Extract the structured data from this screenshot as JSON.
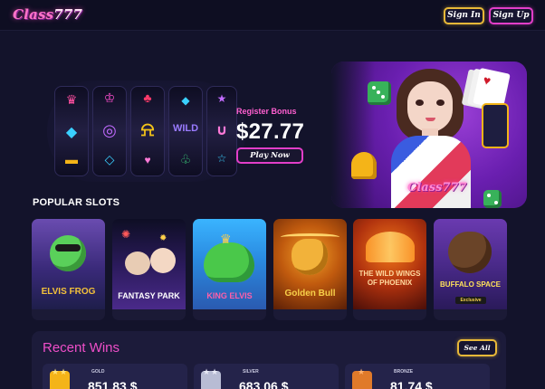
{
  "header": {
    "logo_text_a": "Class",
    "logo_text_b": "777",
    "signin_label": "Sign In",
    "signup_label": "Sign Up"
  },
  "hero": {
    "bonus_title": "Register Bonus",
    "bonus_amount": "$27.77",
    "play_label": "Play Now",
    "promo_logo": "Class777"
  },
  "slots": {
    "section_title": "POPULAR SLOTS",
    "games": [
      {
        "name": "ELVIS FROG",
        "accent": "#f3c13a"
      },
      {
        "name": "FANTASY PARK",
        "accent": "#ffffff"
      },
      {
        "name": "KING ELVIS",
        "accent": "#ff5fa8"
      },
      {
        "name": "Golden Bull",
        "accent": "#f7d04a"
      },
      {
        "name": "THE WILD WINGS OF PHOENIX",
        "accent": "#ffd9a0"
      },
      {
        "name": "BUFFALO SPACE",
        "accent": "#ffe25a",
        "badge": "Exclusive"
      }
    ]
  },
  "wins": {
    "title": "Recent Wins",
    "see_all_label": "See All",
    "entries": [
      {
        "tier": "GOLD",
        "amount": "851.83 $",
        "color": "#f4b418"
      },
      {
        "tier": "SILVER",
        "amount": "683.06 $",
        "color": "#b8bcd4"
      },
      {
        "tier": "BRONZE",
        "amount": "81.74 $",
        "color": "#e07a2a"
      }
    ]
  },
  "colors": {
    "background": "#13132b",
    "accent_pink": "#e23ec9",
    "accent_gold": "#e8b838"
  }
}
